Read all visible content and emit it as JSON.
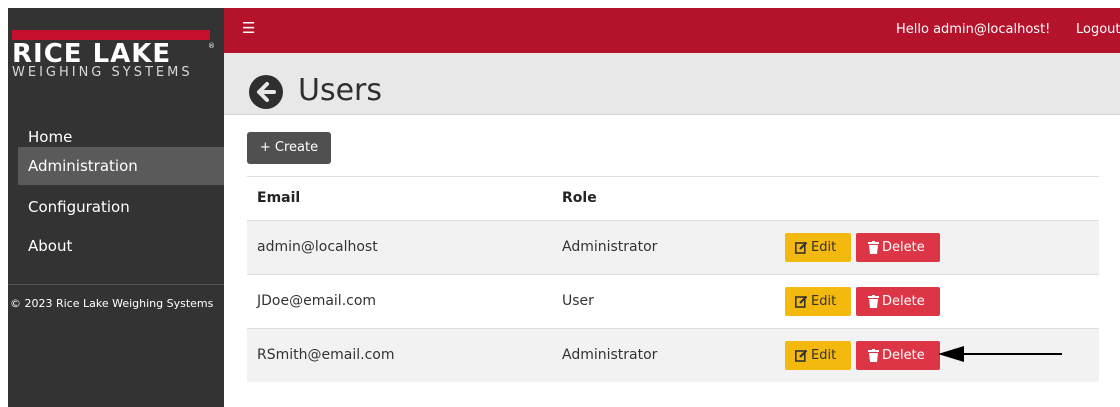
{
  "brand": {
    "name": "RICE LAKE",
    "tagline": "WEIGHING SYSTEMS",
    "registered": "®"
  },
  "topbar": {
    "menu_icon": "hamburger-icon",
    "greeting": "Hello admin@localhost!",
    "logout": "Logout"
  },
  "sidebar": {
    "items": [
      {
        "label": "Home",
        "active": false
      },
      {
        "label": "Administration",
        "active": true
      },
      {
        "label": "Configuration",
        "active": false
      },
      {
        "label": "About",
        "active": false
      }
    ],
    "copyright": "© 2023 Rice Lake Weighing Systems"
  },
  "page": {
    "title": "Users",
    "back_icon": "arrow-left-circle-icon",
    "create_label": "+ Create"
  },
  "table": {
    "columns": [
      "Email",
      "Role"
    ],
    "rows": [
      {
        "email": "admin@localhost",
        "role": "Administrator"
      },
      {
        "email": "JDoe@email.com",
        "role": "User"
      },
      {
        "email": "RSmith@email.com",
        "role": "Administrator"
      }
    ],
    "edit_label": "Edit",
    "delete_label": "Delete"
  },
  "colors": {
    "topbar": "#b5122b",
    "sidebar": "#333333",
    "edit_button": "#f4b90e",
    "delete_button": "#dc3545"
  }
}
